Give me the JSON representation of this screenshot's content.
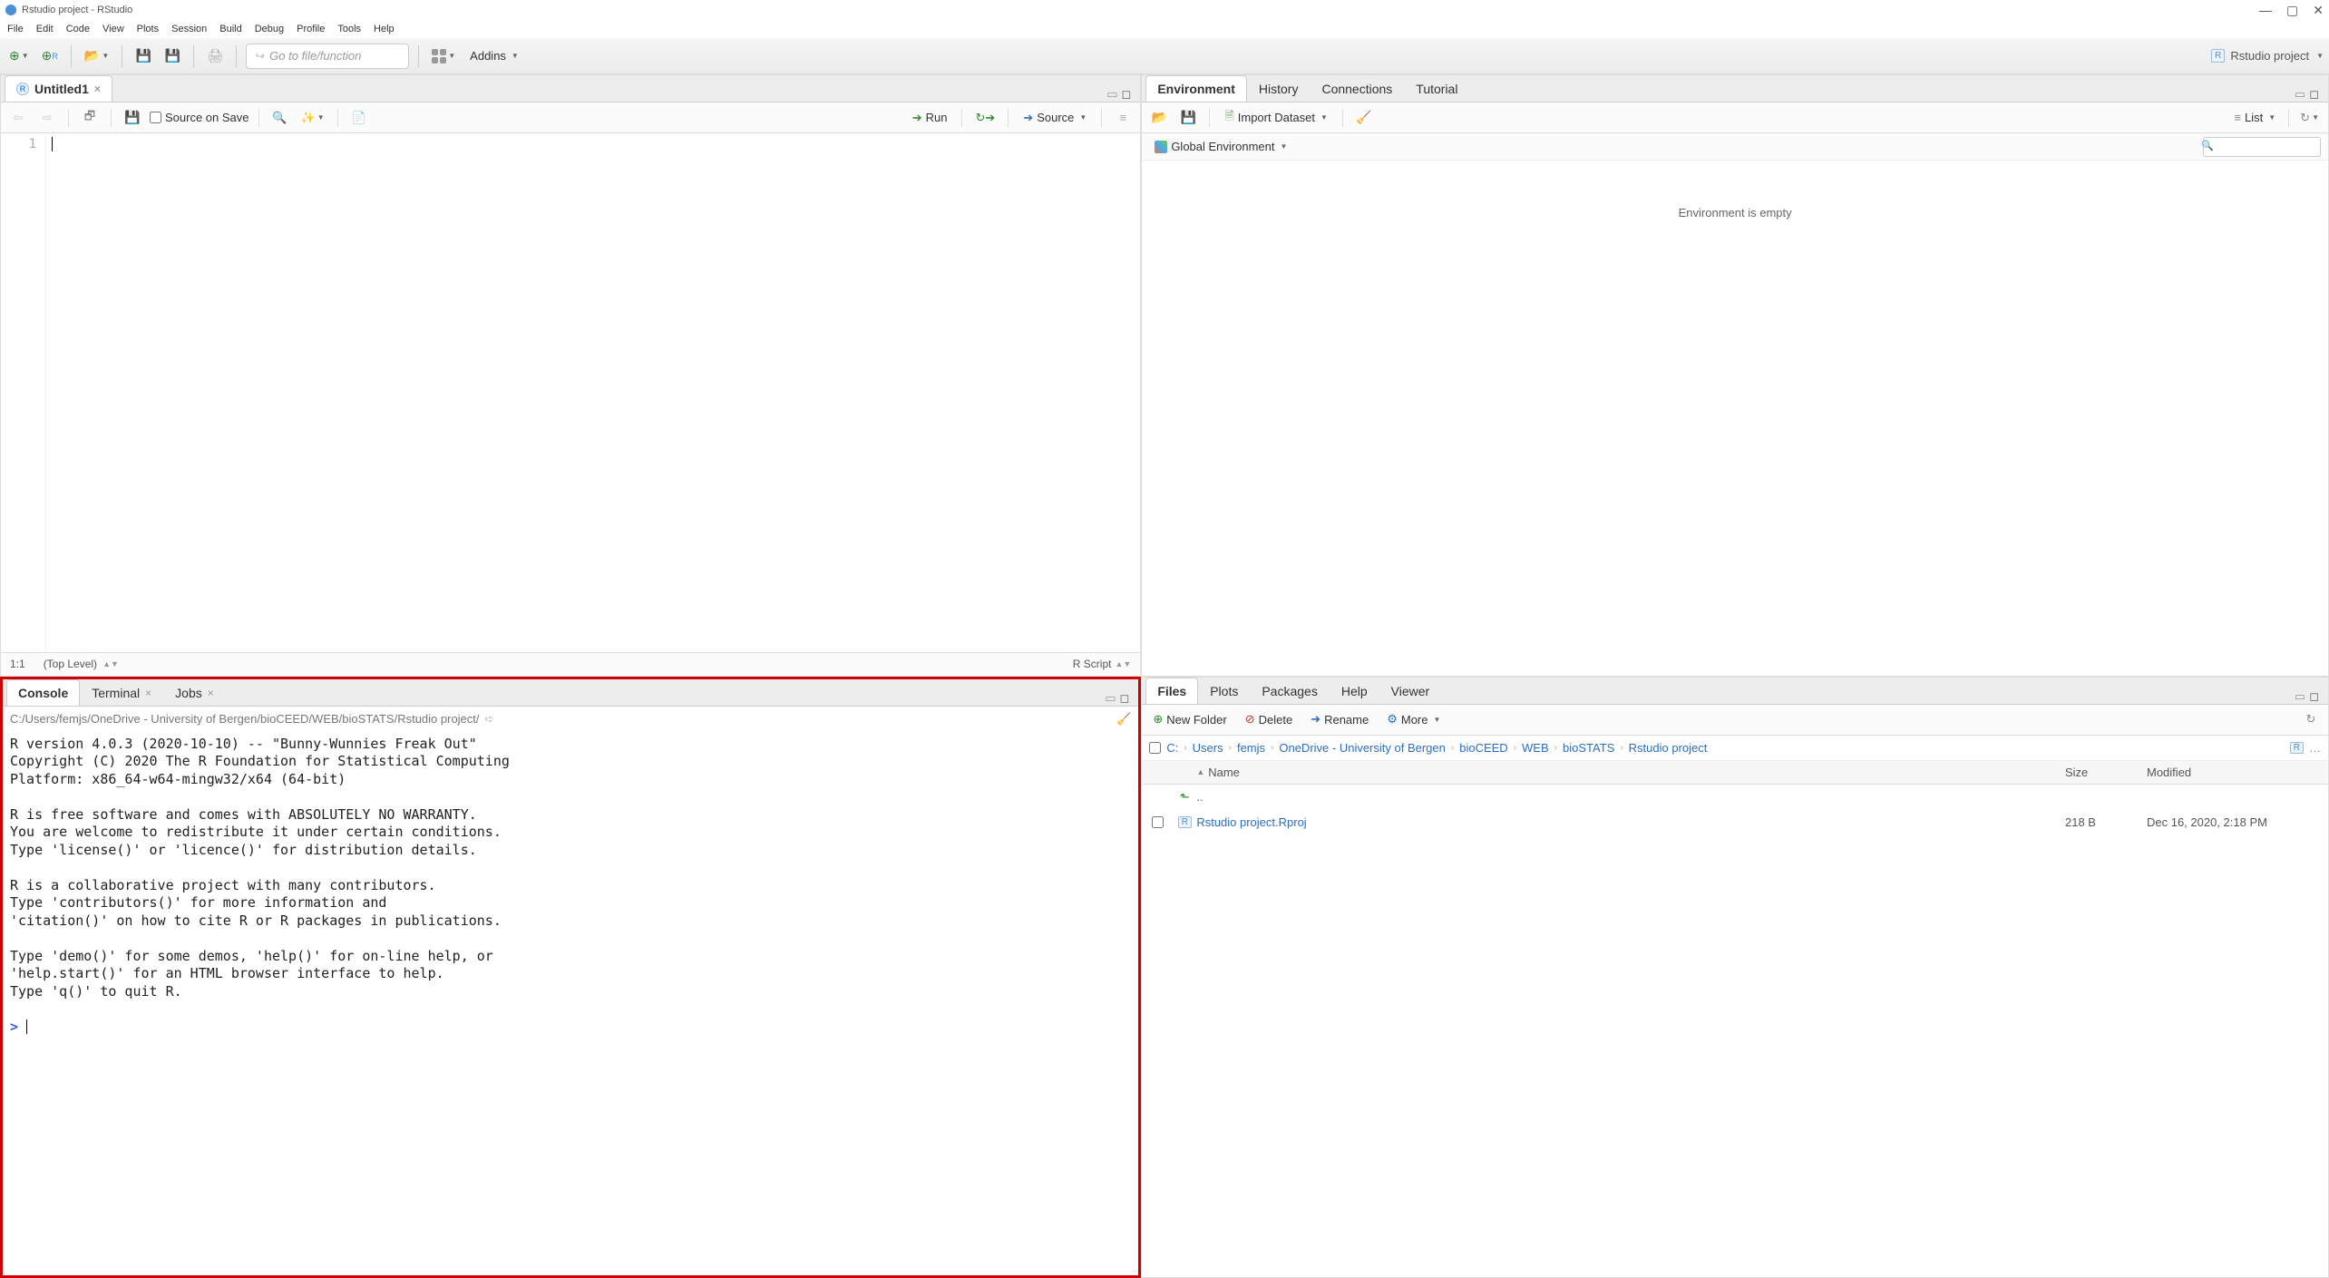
{
  "window": {
    "title": "Rstudio project - RStudio"
  },
  "menu": [
    "File",
    "Edit",
    "Code",
    "View",
    "Plots",
    "Session",
    "Build",
    "Debug",
    "Profile",
    "Tools",
    "Help"
  ],
  "toolbar": {
    "goto_placeholder": "Go to file/function",
    "addins": "Addins",
    "project_picker": "Rstudio project"
  },
  "source": {
    "tab": "Untitled1",
    "source_on_save": "Source on Save",
    "run": "Run",
    "source": "Source",
    "line_no": "1",
    "status_pos": "1:1",
    "status_scope": "(Top Level)",
    "status_lang": "R Script"
  },
  "console": {
    "tabs": [
      "Console",
      "Terminal",
      "Jobs"
    ],
    "path": "C:/Users/femjs/OneDrive - University of Bergen/bioCEED/WEB/bioSTATS/Rstudio project/",
    "output": "R version 4.0.3 (2020-10-10) -- \"Bunny-Wunnies Freak Out\"\nCopyright (C) 2020 The R Foundation for Statistical Computing\nPlatform: x86_64-w64-mingw32/x64 (64-bit)\n\nR is free software and comes with ABSOLUTELY NO WARRANTY.\nYou are welcome to redistribute it under certain conditions.\nType 'license()' or 'licence()' for distribution details.\n\nR is a collaborative project with many contributors.\nType 'contributors()' for more information and\n'citation()' on how to cite R or R packages in publications.\n\nType 'demo()' for some demos, 'help()' for on-line help, or\n'help.start()' for an HTML browser interface to help.\nType 'q()' to quit R.\n",
    "prompt": ">"
  },
  "env": {
    "tabs": [
      "Environment",
      "History",
      "Connections",
      "Tutorial"
    ],
    "import": "Import Dataset",
    "list": "List",
    "scope": "Global Environment",
    "empty": "Environment is empty"
  },
  "files": {
    "tabs": [
      "Files",
      "Plots",
      "Packages",
      "Help",
      "Viewer"
    ],
    "new_folder": "New Folder",
    "delete": "Delete",
    "rename": "Rename",
    "more": "More",
    "breadcrumb": [
      "C:",
      "Users",
      "femjs",
      "OneDrive - University of Bergen",
      "bioCEED",
      "WEB",
      "bioSTATS",
      "Rstudio project"
    ],
    "col_name": "Name",
    "col_size": "Size",
    "col_modified": "Modified",
    "updir": "..",
    "rows": [
      {
        "name": "Rstudio project.Rproj",
        "size": "218 B",
        "modified": "Dec 16, 2020, 2:18 PM"
      }
    ]
  }
}
